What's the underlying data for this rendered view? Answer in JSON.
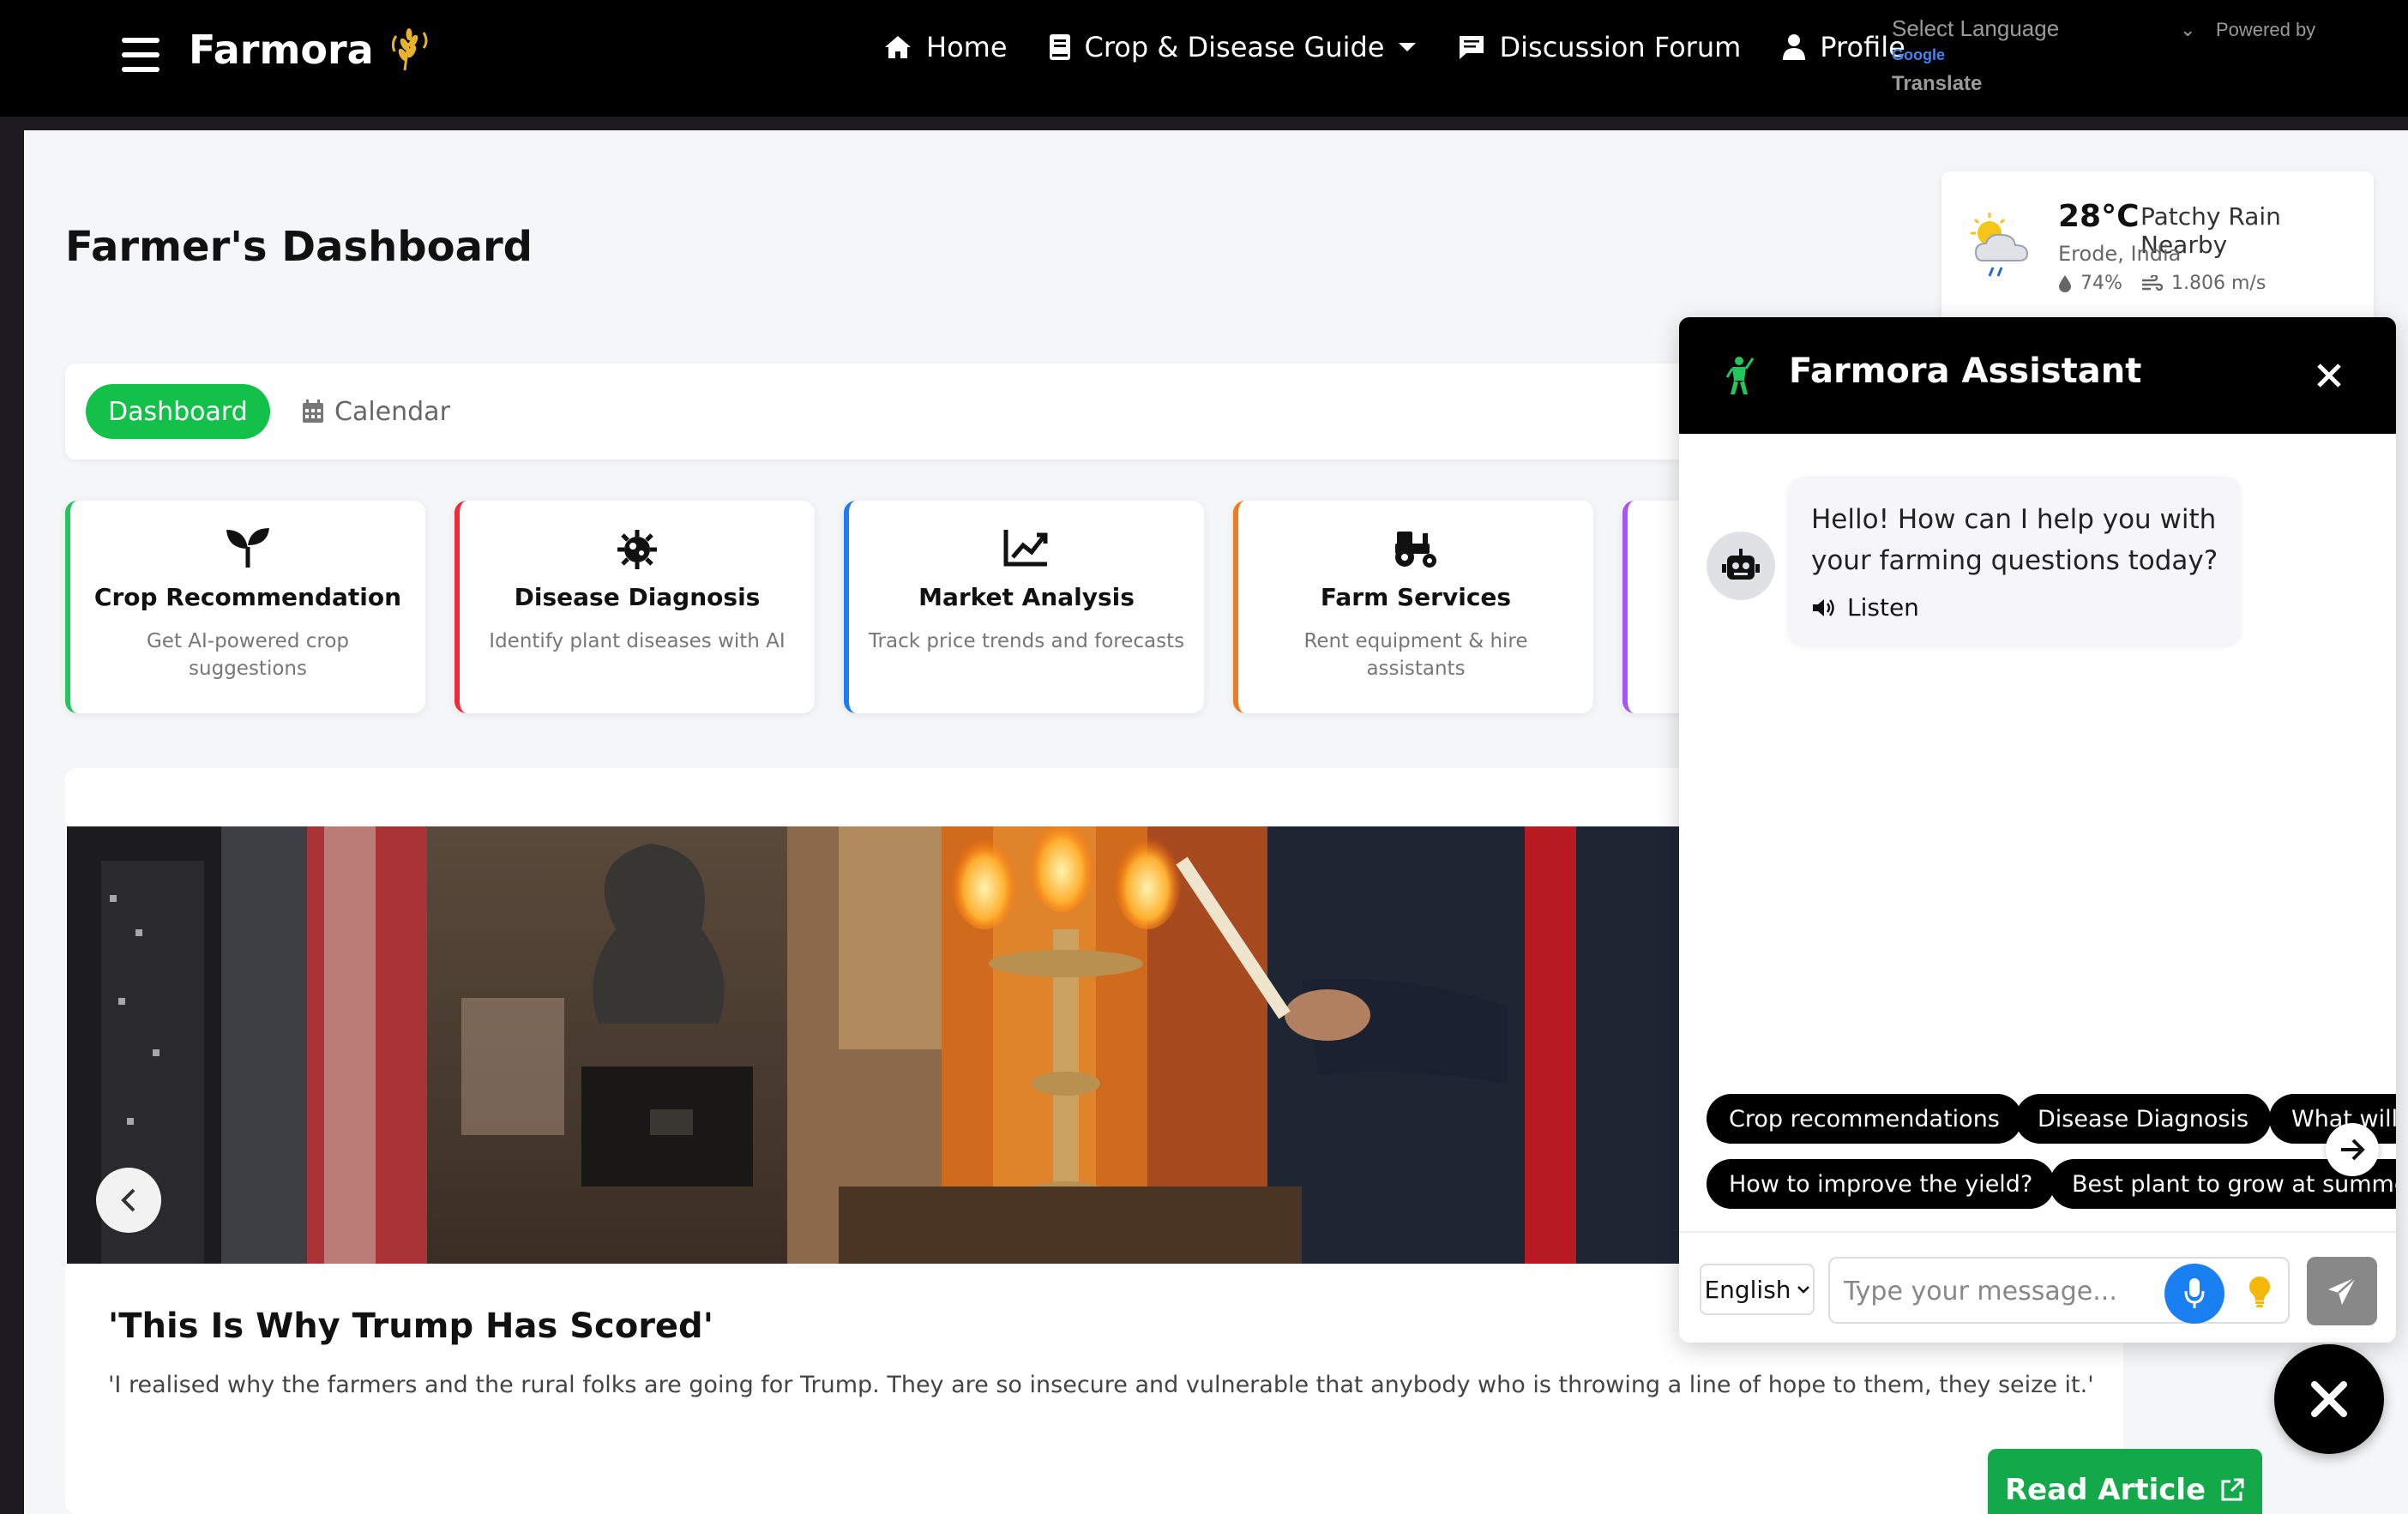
{
  "nav": {
    "brand": "Farmora",
    "links": [
      {
        "label": "Home",
        "icon": "home-icon"
      },
      {
        "label": "Crop & Disease Guide",
        "icon": "book-icon"
      },
      {
        "label": "Discussion Forum",
        "icon": "chat-icon"
      },
      {
        "label": "Profile",
        "icon": "user-icon"
      }
    ],
    "translate": {
      "select_label": "Select Language",
      "powered": "Powered by",
      "google": "Google",
      "translate": "Translate"
    }
  },
  "page": {
    "title": "Farmer's Dashboard"
  },
  "weather": {
    "temp": "28°C",
    "desc": "Patchy Rain Nearby",
    "location": "Erode, India",
    "humidity": "74%",
    "wind": "1.806 m/s"
  },
  "tabs": {
    "active": "Dashboard",
    "other": "Calendar"
  },
  "features": [
    {
      "title": "Crop Recommendation",
      "desc": "Get AI-powered crop suggestions",
      "color": "#22c55e",
      "icon": "sprout-icon"
    },
    {
      "title": "Disease Diagnosis",
      "desc": "Identify plant diseases with AI",
      "color": "#ef2b3b",
      "icon": "virus-icon"
    },
    {
      "title": "Market Analysis",
      "desc": "Track price trends and forecasts",
      "color": "#1e7bf0",
      "icon": "chart-line-icon"
    },
    {
      "title": "Farm Services",
      "desc": "Rent equipment & hire assistants",
      "color": "#f07a1e",
      "icon": "tractor-icon"
    },
    {
      "title": "",
      "desc": "",
      "color": "#a855f7",
      "icon": ""
    }
  ],
  "news": {
    "title": "'This Is Why Trump Has Scored'",
    "desc": "'I realised why the farmers and the rural folks are going for Trump. They are so insecure and vulnerable that anybody who is throwing a line of hope to them, they seize it.'",
    "read_label": "Read Article"
  },
  "chat": {
    "title": "Farmora Assistant",
    "greeting": "Hello! How can I help you with your farming questions today?",
    "listen": "Listen",
    "chips": [
      "Crop recommendations",
      "Disease Diagnosis",
      "What will",
      "How to improve the yield?",
      "Best plant to grow at summer"
    ],
    "language": "English",
    "placeholder": "Type your message..."
  },
  "colors": {
    "accent_green": "#13c14a",
    "read_green": "#13a84a",
    "mic_blue": "#1a7ff0"
  }
}
